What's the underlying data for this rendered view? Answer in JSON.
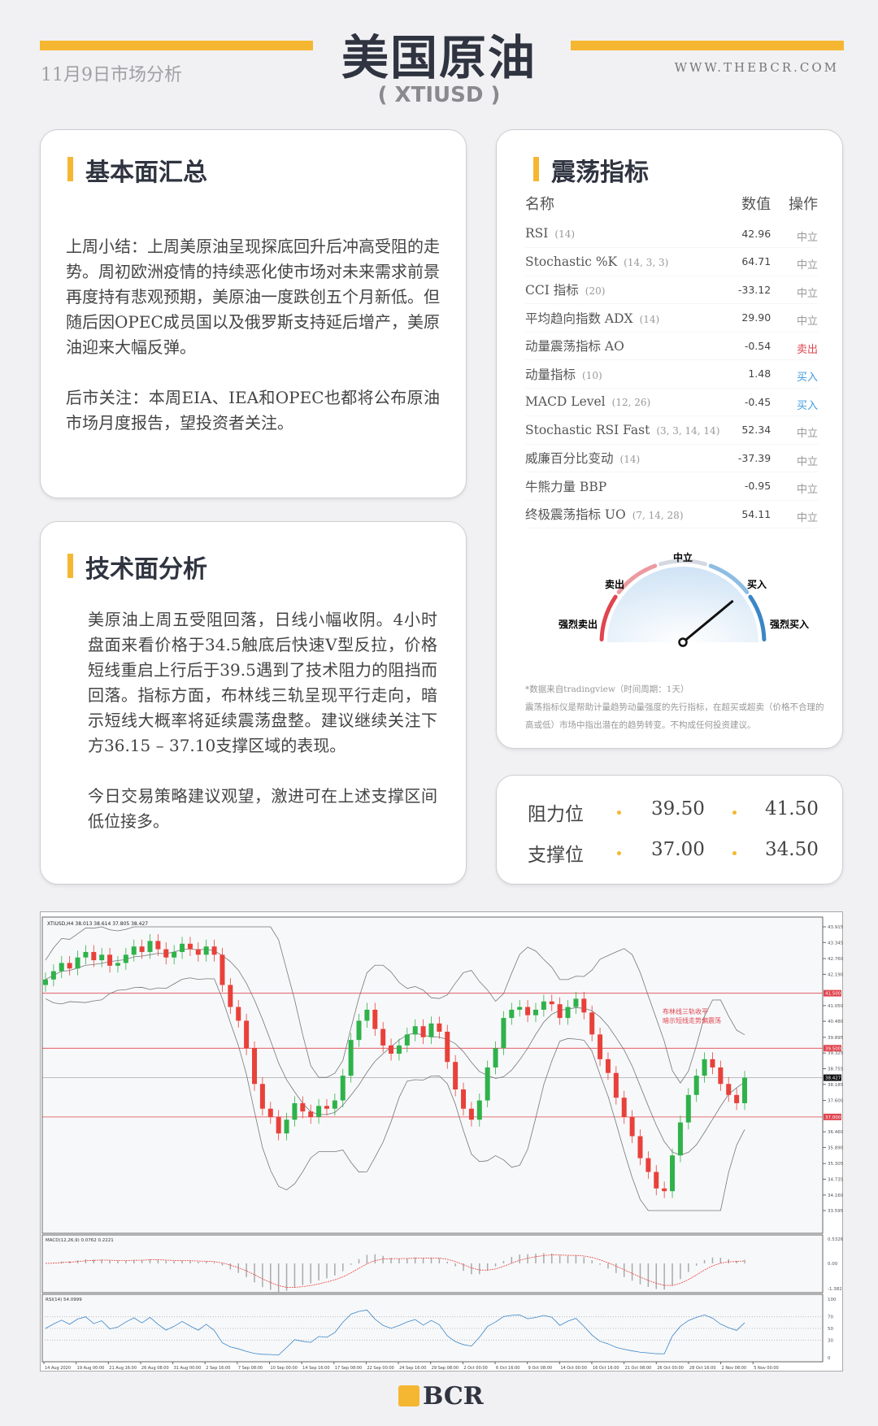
{
  "header": {
    "title": "美国原油",
    "symbol": "( XTIUSD )",
    "date": "11月9日市场分析",
    "website": "WWW.THEBCR.COM",
    "accent": "#f5b731"
  },
  "fundamentals": {
    "title": "基本面汇总",
    "paragraphs": [
      "上周小结：上周美原油呈现探底回升后冲高受阻的走势。周初欧洲疫情的持续恶化使市场对未来需求前景再度持有悲观预期，美原油一度跌创五个月新低。但随后因OPEC成员国以及俄罗斯支持延后增产，美原油迎来大幅反弹。",
      "后市关注：本周EIA、IEA和OPEC也都将公布原油市场月度报告，望投资者关注。"
    ]
  },
  "technical": {
    "title": "技术面分析",
    "paragraphs": [
      "美原油上周五受阻回落，日线小幅收阴。4小时盘面来看价格于34.5触底后快速V型反拉，价格短线重启上行后于39.5遇到了技术阻力的阻挡而回落。指标方面，布林线三轨呈现平行走向，暗示短线大概率将延续震荡盘整。建议继续关注下方36.15 – 37.10支撑区域的表现。",
      "今日交易策略建议观望，激进可在上述支撑区间低位接多。"
    ]
  },
  "oscillators": {
    "title": "震荡指标",
    "columns": [
      "名称",
      "数值",
      "操作"
    ],
    "rows": [
      {
        "name": "RSI",
        "params": "(14)",
        "value": "42.96",
        "action": "中立"
      },
      {
        "name": "Stochastic %K",
        "params": "(14, 3, 3)",
        "value": "64.71",
        "action": "中立"
      },
      {
        "name": "CCI 指标",
        "params": "(20)",
        "value": "-33.12",
        "action": "中立"
      },
      {
        "name": "平均趋向指数 ADX",
        "params": "(14)",
        "value": "29.90",
        "action": "中立"
      },
      {
        "name": "动量震荡指标 AO",
        "params": "",
        "value": "-0.54",
        "action": "卖出"
      },
      {
        "name": "动量指标",
        "params": "(10)",
        "value": "1.48",
        "action": "买入"
      },
      {
        "name": "MACD Level",
        "params": "(12, 26)",
        "value": "-0.45",
        "action": "买入"
      },
      {
        "name": "Stochastic RSI Fast",
        "params": "(3, 3, 14, 14)",
        "value": "52.34",
        "action": "中立"
      },
      {
        "name": "威廉百分比变动",
        "params": "(14)",
        "value": "-37.39",
        "action": "中立"
      },
      {
        "name": "牛熊力量 BBP",
        "params": "",
        "value": "-0.95",
        "action": "中立"
      },
      {
        "name": "终极震荡指标 UO",
        "params": "(7, 14, 28)",
        "value": "54.11",
        "action": "中立"
      }
    ],
    "action_colors": {
      "卖出": "#e0454f",
      "买入": "#3b9be0",
      "中立": "#999999"
    },
    "gauge": {
      "labels": {
        "strong_sell": "强烈卖出",
        "sell": "卖出",
        "neutral": "中立",
        "buy": "买入",
        "strong_buy": "强烈买入"
      },
      "reading": "买入",
      "needle_fraction": 0.78
    },
    "source_note": "*数据来自tradingview（时间周期：1天）",
    "disclaimer": "震荡指标仪是帮助计量趋势动量强度的先行指标，在超买或超卖（价格不合理的高或低）市场中指出潜在的趋势转变。不构成任何投资建议。"
  },
  "levels": {
    "resistance_label": "阻力位",
    "resistance": [
      "39.50",
      "41.50"
    ],
    "support_label": "支撑位",
    "support": [
      "37.00",
      "34.50"
    ]
  },
  "chart_data": {
    "type": "candlestick",
    "title": "XTIUSD,H4 38.013 38.614 37.805 38.427",
    "ylim": [
      33.595,
      43.915
    ],
    "y_ticks": [
      "43.915",
      "43.345",
      "42.760",
      "42.190",
      "41.050",
      "40.480",
      "39.895",
      "39.325",
      "38.755",
      "38.185",
      "37.600",
      "36.460",
      "35.890",
      "35.305",
      "34.735",
      "34.160",
      "33.595"
    ],
    "hlines": [
      {
        "value": 41.5,
        "label": "41.500"
      },
      {
        "value": 39.5,
        "label": "39.500"
      },
      {
        "value": 37.0,
        "label": "37.000"
      }
    ],
    "last_price": {
      "value": 38.427,
      "label": "38.427"
    },
    "annotation": [
      "布林线三轨收平",
      "暗示短线走势偏震荡"
    ],
    "x_ticks": [
      "14 Aug 2020",
      "19 Aug 00:00",
      "21 Aug 16:00",
      "26 Aug 08:00",
      "31 Aug 00:00",
      "2 Sep 16:00",
      "7 Sep 08:00",
      "10 Sep 00:00",
      "14 Sep 16:00",
      "17 Sep 08:00",
      "22 Sep 00:00",
      "24 Sep 16:00",
      "29 Sep 08:00",
      "2 Oct 00:00",
      "6 Oct 16:00",
      "9 Oct 08:00",
      "14 Oct 00:00",
      "16 Oct 16:00",
      "21 Oct 08:00",
      "26 Oct 00:00",
      "28 Oct 16:00",
      "2 Nov 08:00",
      "5 Nov 00:00"
    ],
    "closes": [
      42.0,
      42.3,
      42.6,
      42.4,
      42.8,
      43.0,
      42.7,
      42.9,
      42.5,
      42.6,
      42.9,
      43.2,
      43.0,
      43.4,
      43.1,
      42.8,
      43.0,
      43.3,
      43.1,
      42.9,
      43.2,
      42.9,
      41.8,
      41.0,
      40.5,
      39.5,
      38.2,
      37.3,
      37.0,
      36.4,
      36.9,
      37.5,
      37.2,
      37.0,
      37.4,
      37.3,
      37.6,
      38.5,
      39.8,
      40.5,
      40.9,
      40.2,
      39.6,
      39.3,
      39.6,
      40.0,
      40.3,
      39.9,
      40.4,
      40.1,
      39.0,
      38.0,
      37.3,
      36.9,
      37.6,
      38.8,
      39.5,
      40.6,
      40.9,
      41.0,
      40.7,
      40.9,
      41.2,
      41.1,
      40.6,
      41.0,
      41.3,
      40.8,
      40.0,
      39.1,
      38.6,
      37.7,
      37.0,
      36.3,
      35.5,
      35.0,
      34.4,
      34.3,
      35.6,
      36.8,
      37.8,
      38.5,
      39.1,
      38.8,
      38.2,
      37.8,
      37.5,
      38.427
    ],
    "macd": {
      "title": "MACD(12,26,9) 0.0762 0.2221",
      "ticks": [
        "0.5326",
        "0.00",
        "-1.382"
      ]
    },
    "rsi": {
      "title": "RSI(14) 54.0999",
      "ticks": [
        "100",
        "70",
        "50",
        "30",
        "0"
      ]
    },
    "colors": {
      "up": "#2fb24a",
      "down": "#e8413a",
      "band": "#777777",
      "level": "#e0454f"
    }
  },
  "footer": {
    "logo": "BCR"
  }
}
